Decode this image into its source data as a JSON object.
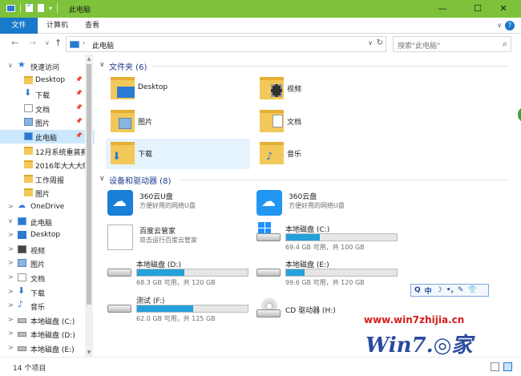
{
  "window": {
    "title": "此电脑",
    "minimize": "—",
    "maximize": "☐",
    "close": "✕"
  },
  "ribbon": {
    "tabs": [
      "文件",
      "计算机",
      "查看"
    ],
    "help": "?"
  },
  "address": {
    "path": "此电脑",
    "search_placeholder": "搜索\"此电脑\""
  },
  "nav": {
    "items": [
      {
        "label": "快速访问",
        "icon": "star-icon",
        "indent": 0,
        "arrow": "∨"
      },
      {
        "label": "Desktop",
        "icon": "folder-icon",
        "pinned": true
      },
      {
        "label": "下载",
        "icon": "download-icon",
        "pinned": true
      },
      {
        "label": "文档",
        "icon": "document-icon",
        "pinned": true
      },
      {
        "label": "图片",
        "icon": "pictures-icon",
        "pinned": true
      },
      {
        "label": "此电脑",
        "icon": "computer-icon",
        "pinned": true,
        "selected": true
      },
      {
        "label": "12月系统重装赛",
        "icon": "folder-icon"
      },
      {
        "label": "2016年大大大帽",
        "icon": "folder-icon"
      },
      {
        "label": "工作周报",
        "icon": "folder-icon"
      },
      {
        "label": "图片",
        "icon": "folder-icon"
      },
      {
        "label": "OneDrive",
        "icon": "cloud-icon",
        "arrow": ">"
      },
      {
        "label": "此电脑",
        "icon": "computer-icon",
        "arrow": "∨"
      },
      {
        "label": "Desktop",
        "icon": "desktop-icon",
        "arrow": ">"
      },
      {
        "label": "视频",
        "icon": "video-icon",
        "arrow": ">"
      },
      {
        "label": "图片",
        "icon": "pictures-icon",
        "arrow": ">"
      },
      {
        "label": "文档",
        "icon": "document-icon",
        "arrow": ">"
      },
      {
        "label": "下载",
        "icon": "download-icon",
        "arrow": ">"
      },
      {
        "label": "音乐",
        "icon": "music-icon",
        "arrow": ">"
      },
      {
        "label": "本地磁盘 (C:)",
        "icon": "drive-icon",
        "arrow": ">"
      },
      {
        "label": "本地磁盘 (D:)",
        "icon": "drive-icon",
        "arrow": ">"
      },
      {
        "label": "本地磁盘 (E:)",
        "icon": "drive-icon",
        "arrow": ">"
      }
    ]
  },
  "folders": {
    "header": "文件夹 (6)",
    "items": [
      {
        "label": "Desktop",
        "kind": "desktop"
      },
      {
        "label": "视频",
        "kind": "video"
      },
      {
        "label": "图片",
        "kind": "pictures"
      },
      {
        "label": "文档",
        "kind": "documents"
      },
      {
        "label": "下载",
        "kind": "downloads",
        "selected": true
      },
      {
        "label": "音乐",
        "kind": "music"
      }
    ]
  },
  "devices": {
    "header": "设备和驱动器 (8)",
    "apps": [
      {
        "name": "360云U盘",
        "sub": "方便好用的网络U盘",
        "icon": "u-disk-icon"
      },
      {
        "name": "360云盘",
        "sub": "方便好用的网络U盘",
        "icon": "cloud-disk-icon"
      },
      {
        "name": "百度云管家",
        "sub": "双击运行百度云管家",
        "icon": "baidu-icon"
      }
    ],
    "drives": [
      {
        "name": "本地磁盘 (C:)",
        "free": "69.4 GB 可用，共 100 GB",
        "used_fraction": 0.306,
        "system": true
      },
      {
        "name": "本地磁盘 (D:)",
        "free": "68.3 GB 可用，共 120 GB",
        "used_fraction": 0.431
      },
      {
        "name": "本地磁盘 (E:)",
        "free": "99.6 GB 可用，共 120 GB",
        "used_fraction": 0.17
      },
      {
        "name": "测试 (F:)",
        "free": "62.0 GB 可用，共 125 GB",
        "used_fraction": 0.504
      }
    ],
    "cd": {
      "name": "CD 驱动器 (H:)"
    }
  },
  "ime": [
    "Q",
    "中",
    "☽",
    "•,",
    "✎",
    "👕"
  ],
  "watermark": {
    "url": "www.win7zhijia.cn",
    "logo": "Win7.◎家"
  },
  "status": {
    "count": "14 个项目"
  },
  "colors": {
    "titlebar": "#7ec13a",
    "accent": "#1979ca",
    "drive_fill": "#26a0da",
    "group_title": "#1e3b8a"
  }
}
